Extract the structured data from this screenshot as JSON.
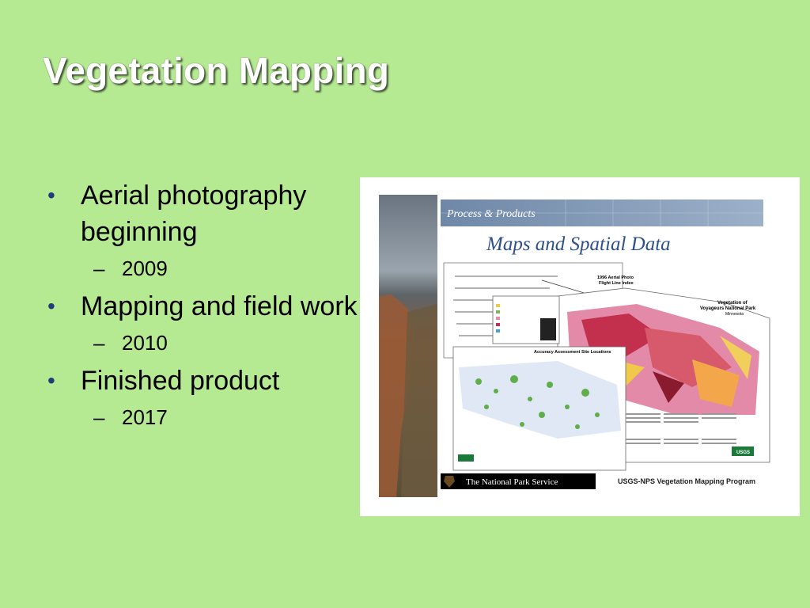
{
  "slide": {
    "title": "Vegetation Mapping",
    "bullets": [
      {
        "text": "Aerial photography beginning",
        "sub": "2009"
      },
      {
        "text": "Mapping and field work",
        "sub": "2010"
      },
      {
        "text": "Finished product",
        "sub": "2017"
      }
    ]
  },
  "poster": {
    "banner": "Process & Products",
    "heading": "Maps and Spatial Data",
    "flight_index": "1996 Aerial Photo\nFlight Line Index",
    "park_title": "Vegetation of\nVoyageurs National Park\nMinnesota",
    "accuracy_title": "Accuracy Assessment Site Locations",
    "nps_footer": "The National Park Service",
    "program": "USGS-NPS Vegetation Mapping Program",
    "usgs_label": "USGS"
  }
}
